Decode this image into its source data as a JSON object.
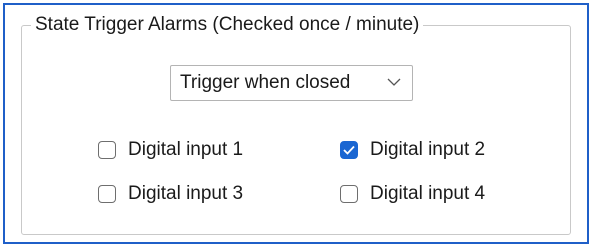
{
  "groupbox": {
    "title": "State Trigger Alarms (Checked once / minute)"
  },
  "trigger": {
    "selected": "Trigger when closed",
    "icon": "chevron-down-icon"
  },
  "colors": {
    "accent": "#1a66d2",
    "frame_border": "#1f5fc8",
    "group_border": "#c9c9c9"
  },
  "inputs": [
    {
      "label": "Digital input 1",
      "checked": false
    },
    {
      "label": "Digital input 2",
      "checked": true
    },
    {
      "label": "Digital input 3",
      "checked": false
    },
    {
      "label": "Digital input 4",
      "checked": false
    }
  ]
}
